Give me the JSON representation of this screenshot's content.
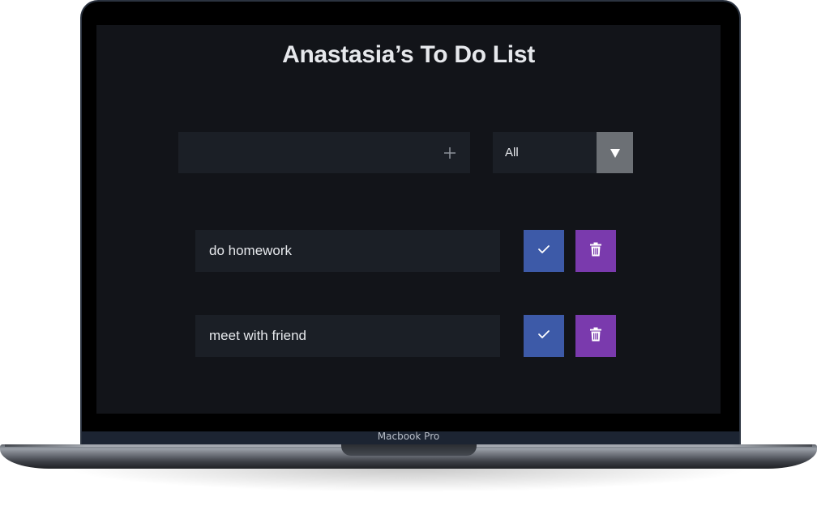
{
  "app": {
    "title": "Anastasia’s To Do List"
  },
  "form": {
    "input_value": "",
    "add_icon": "plus-icon"
  },
  "filter": {
    "selected": "All",
    "arrow_icon": "triangle-down-icon"
  },
  "todos": [
    {
      "text": "do homework",
      "complete_icon": "check-icon",
      "delete_icon": "trash-icon"
    },
    {
      "text": "meet with friend",
      "complete_icon": "check-icon",
      "delete_icon": "trash-icon"
    }
  ],
  "device": {
    "label": "Macbook Pro"
  },
  "colors": {
    "screen_bg": "#121419",
    "field_bg": "#1b1f26",
    "complete_button": "#3d5aa8",
    "trash_button": "#7a3aad",
    "select_arrow_bg": "#6c7075",
    "text": "#e6e8ec"
  }
}
